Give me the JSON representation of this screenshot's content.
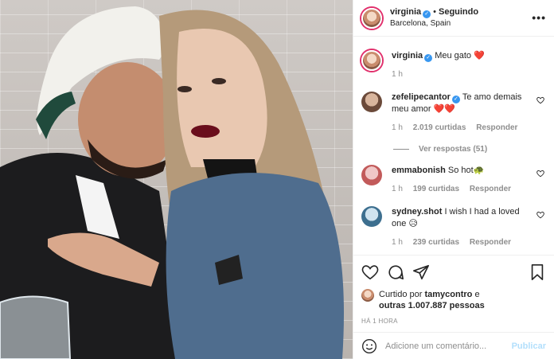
{
  "header": {
    "username": "virginia",
    "separator": "•",
    "follow_status": "Seguindo",
    "location": "Barcelona, Spain",
    "more_icon": "ellipsis-icon"
  },
  "caption": {
    "username": "virginia",
    "text": "Meu gato",
    "emoji": "❤️",
    "time": "1 h"
  },
  "comments": [
    {
      "username": "zefelipecantor",
      "verified": true,
      "text": "Te amo demais meu amor",
      "emoji": "❤️❤️",
      "time": "1 h",
      "likes": "2.019 curtidas",
      "reply": "Responder",
      "view_replies": "Ver respostas (51)"
    },
    {
      "username": "emmabonish",
      "text": "So hot",
      "emoji": "🐢",
      "time": "1 h",
      "likes": "199 curtidas",
      "reply": "Responder"
    },
    {
      "username": "sydney.shot",
      "text": "I wish I had a loved one",
      "emoji": "😥",
      "time": "1 h",
      "likes": "239 curtidas",
      "reply": "Responder"
    }
  ],
  "actions": {
    "like_icon": "heart-icon",
    "comment_icon": "comment-icon",
    "share_icon": "paper-plane-icon",
    "save_icon": "bookmark-icon"
  },
  "likes": {
    "prefix": "Curtido por",
    "user": "tamycontro",
    "joiner": "e",
    "others": "outras 1.007.887 pessoas"
  },
  "post_time": "HÁ 1 HORA",
  "add_comment": {
    "placeholder": "Adicione um comentário...",
    "publish_label": "Publicar"
  },
  "colors": {
    "verified": "#3897f0",
    "heart": "#e0245e",
    "publish_disabled": "#b2dffc",
    "story_ring": "#e1306c"
  }
}
